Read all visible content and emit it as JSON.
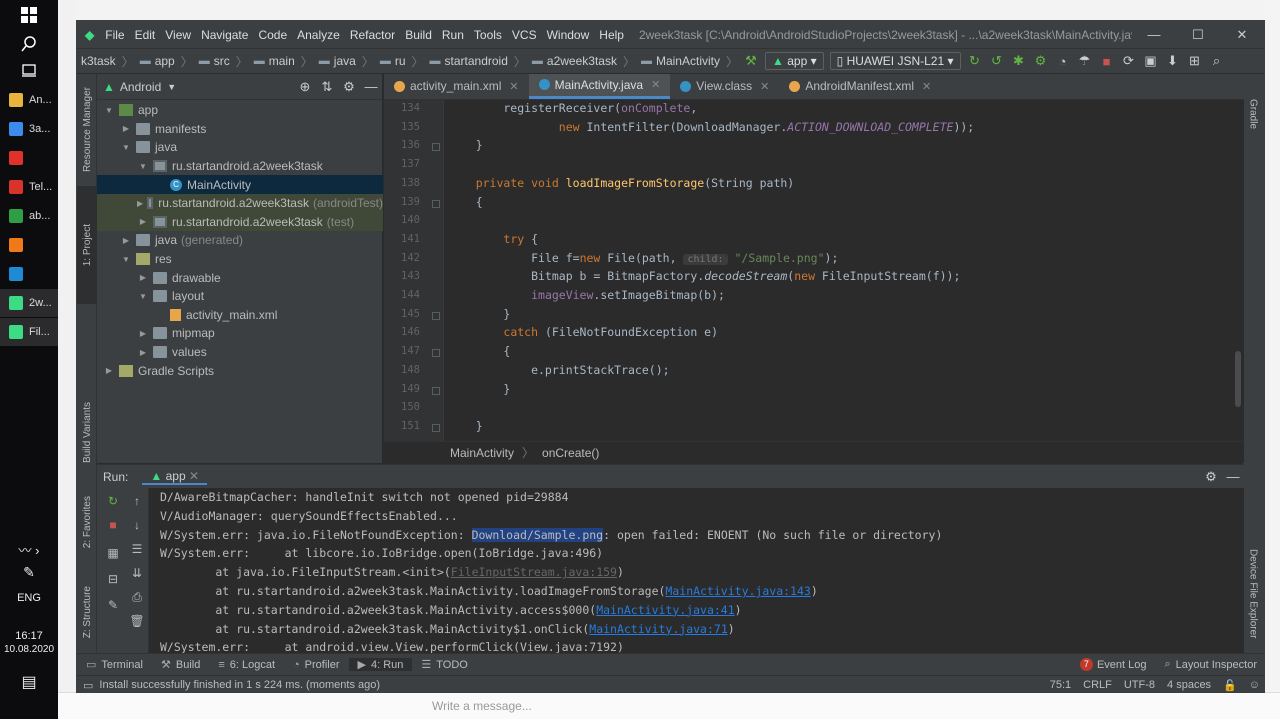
{
  "taskbar": {
    "items": [
      {
        "label": "An...",
        "icon": "folder-icon",
        "color": "#e8b43c"
      },
      {
        "label": "3a...",
        "icon": "download-icon",
        "color": "#3c8cf0"
      },
      {
        "label": "",
        "icon": "yandex-icon",
        "color": "#e0312b"
      },
      {
        "label": "Tel...",
        "icon": "telegram-icon",
        "color": "#d9332a"
      },
      {
        "label": "ab...",
        "icon": "chrome-icon",
        "color": "#2f9e45"
      },
      {
        "label": "",
        "icon": "firefox-icon",
        "color": "#f07a1a"
      },
      {
        "label": "",
        "icon": "edge-icon",
        "color": "#1f8bd6"
      },
      {
        "label": "2w...",
        "icon": "android-studio-icon",
        "color": "#3ddc84"
      },
      {
        "label": "Fil...",
        "icon": "android-studio-icon",
        "color": "#3ddc84"
      }
    ],
    "language": "ENG",
    "time": "16:17",
    "date": "10.08.2020"
  },
  "menu": [
    "File",
    "Edit",
    "View",
    "Navigate",
    "Code",
    "Analyze",
    "Refactor",
    "Build",
    "Run",
    "Tools",
    "VCS",
    "Window",
    "Help"
  ],
  "window_title": "2week3task [C:\\Android\\AndroidStudioProjects\\2week3task] - ...\\a2week3task\\MainActivity.java [app]",
  "breadcrumb": [
    "k3task",
    "app",
    "src",
    "main",
    "java",
    "ru",
    "startandroid",
    "a2week3task",
    "MainActivity"
  ],
  "run_config": "app",
  "device": "HUAWEI JSN-L21",
  "project_panel": {
    "view_mode": "Android",
    "tree": [
      {
        "label": "app",
        "depth": 0,
        "icon": "app",
        "open": true
      },
      {
        "label": "manifests",
        "depth": 1,
        "icon": "folder",
        "open": false
      },
      {
        "label": "java",
        "depth": 1,
        "icon": "folder",
        "open": true
      },
      {
        "label": "ru.startandroid.a2week3task",
        "depth": 2,
        "icon": "pkg",
        "open": true
      },
      {
        "label": "MainActivity",
        "depth": 3,
        "icon": "class",
        "selected": true
      },
      {
        "label": "ru.startandroid.a2week3task",
        "suffix": "(androidTest)",
        "depth": 2,
        "icon": "pkg",
        "open": false,
        "tinted": true
      },
      {
        "label": "ru.startandroid.a2week3task",
        "suffix": "(test)",
        "depth": 2,
        "icon": "pkg",
        "open": false,
        "tinted": true
      },
      {
        "label": "java",
        "suffix": "(generated)",
        "depth": 1,
        "icon": "folder",
        "open": false
      },
      {
        "label": "res",
        "depth": 1,
        "icon": "res",
        "open": true
      },
      {
        "label": "drawable",
        "depth": 2,
        "icon": "folder",
        "open": false
      },
      {
        "label": "layout",
        "depth": 2,
        "icon": "folder",
        "open": true
      },
      {
        "label": "activity_main.xml",
        "depth": 3,
        "icon": "file"
      },
      {
        "label": "mipmap",
        "depth": 2,
        "icon": "folder",
        "open": false
      },
      {
        "label": "values",
        "depth": 2,
        "icon": "folder",
        "open": false
      },
      {
        "label": "Gradle Scripts",
        "depth": 0,
        "icon": "gradle",
        "open": false
      }
    ]
  },
  "left_tool_tabs": [
    "Resource Manager",
    "1: Project",
    "Build Variants",
    "2: Favorites",
    "Z: Structure"
  ],
  "right_tool_tabs": [
    "Gradle",
    "Device File Explorer"
  ],
  "editor_tabs": [
    {
      "label": "activity_main.xml",
      "color": "#e8a64c",
      "active": false
    },
    {
      "label": "MainActivity.java",
      "color": "#3592c4",
      "active": true
    },
    {
      "label": "View.class",
      "color": "#3592c4",
      "active": false
    },
    {
      "label": "AndroidManifest.xml",
      "color": "#e8a64c",
      "active": false
    }
  ],
  "code": {
    "line_numbers": [
      "134",
      "135",
      "136",
      "137",
      "138",
      "139",
      "140",
      "141",
      "142",
      "143",
      "144",
      "145",
      "146",
      "147",
      "148",
      "149",
      "150",
      "151"
    ],
    "lines": [
      [
        {
          "t": "        registerReceiver(",
          "c": ""
        },
        {
          "t": "onComplete",
          "c": "fld"
        },
        {
          "t": ",",
          "c": ""
        }
      ],
      [
        {
          "t": "                ",
          "c": ""
        },
        {
          "t": "new ",
          "c": "kw"
        },
        {
          "t": "IntentFilter(DownloadManager.",
          "c": ""
        },
        {
          "t": "ACTION_DOWNLOAD_COMPLETE",
          "c": "fld itl"
        },
        {
          "t": "));",
          "c": ""
        }
      ],
      [
        {
          "t": "    }",
          "c": ""
        }
      ],
      [
        {
          "t": "",
          "c": ""
        }
      ],
      [
        {
          "t": "    ",
          "c": ""
        },
        {
          "t": "private void ",
          "c": "kw"
        },
        {
          "t": "loadImageFromStorage",
          "c": "fn"
        },
        {
          "t": "(String path)",
          "c": ""
        }
      ],
      [
        {
          "t": "    {",
          "c": ""
        }
      ],
      [
        {
          "t": "",
          "c": ""
        }
      ],
      [
        {
          "t": "        ",
          "c": ""
        },
        {
          "t": "try ",
          "c": "kw"
        },
        {
          "t": "{",
          "c": ""
        }
      ],
      [
        {
          "t": "            File f=",
          "c": ""
        },
        {
          "t": "new ",
          "c": "kw"
        },
        {
          "t": "File(path, ",
          "c": ""
        },
        {
          "t": "child:",
          "c": "hint"
        },
        {
          "t": " ",
          "c": ""
        },
        {
          "t": "\"/Sample.png\"",
          "c": "str"
        },
        {
          "t": ");",
          "c": ""
        }
      ],
      [
        {
          "t": "            Bitmap b = BitmapFactory.",
          "c": ""
        },
        {
          "t": "decodeStream",
          "c": "itl"
        },
        {
          "t": "(",
          "c": ""
        },
        {
          "t": "new ",
          "c": "kw"
        },
        {
          "t": "FileInputStream(f));",
          "c": ""
        }
      ],
      [
        {
          "t": "            ",
          "c": ""
        },
        {
          "t": "imageView",
          "c": "fld"
        },
        {
          "t": ".setImageBitmap(b);",
          "c": ""
        }
      ],
      [
        {
          "t": "        }",
          "c": ""
        }
      ],
      [
        {
          "t": "        ",
          "c": ""
        },
        {
          "t": "catch ",
          "c": "kw"
        },
        {
          "t": "(FileNotFoundException e)",
          "c": ""
        }
      ],
      [
        {
          "t": "        {",
          "c": ""
        }
      ],
      [
        {
          "t": "            e.printStackTrace();",
          "c": ""
        }
      ],
      [
        {
          "t": "        }",
          "c": ""
        }
      ],
      [
        {
          "t": "",
          "c": ""
        }
      ],
      [
        {
          "t": "    }",
          "c": ""
        }
      ]
    ]
  },
  "editor_breadcrumb": [
    "MainActivity",
    "onCreate()"
  ],
  "run_panel": {
    "title": "Run:",
    "tab": "app",
    "lines": [
      [
        {
          "t": "D/AwareBitmapCacher: handleInit switch not opened pid=29884",
          "c": ""
        }
      ],
      [
        {
          "t": "V/AudioManager: querySoundEffectsEnabled...",
          "c": ""
        }
      ],
      [
        {
          "t": "W/System.err: java.io.FileNotFoundException: ",
          "c": ""
        },
        {
          "t": "Download/Sample.png",
          "c": "sel"
        },
        {
          "t": ": open failed: ENOENT (No such file or directory)",
          "c": ""
        }
      ],
      [
        {
          "t": "W/System.err:     at libcore.io.IoBridge.open(IoBridge.java:496)",
          "c": ""
        }
      ],
      [
        {
          "t": "        at java.io.FileInputStream.<init>(",
          "c": ""
        },
        {
          "t": "FileInputStream.java:159",
          "c": "lnk-dim"
        },
        {
          "t": ")",
          "c": ""
        }
      ],
      [
        {
          "t": "        at ru.startandroid.a2week3task.MainActivity.loadImageFromStorage(",
          "c": ""
        },
        {
          "t": "MainActivity.java:143",
          "c": "lnk"
        },
        {
          "t": ")",
          "c": ""
        }
      ],
      [
        {
          "t": "        at ru.startandroid.a2week3task.MainActivity.access$000(",
          "c": ""
        },
        {
          "t": "MainActivity.java:41",
          "c": "lnk"
        },
        {
          "t": ")",
          "c": ""
        }
      ],
      [
        {
          "t": "        at ru.startandroid.a2week3task.MainActivity$1.onClick(",
          "c": ""
        },
        {
          "t": "MainActivity.java:71",
          "c": "lnk"
        },
        {
          "t": ")",
          "c": ""
        }
      ],
      [
        {
          "t": "W/System.err:     at android.view.View.performClick(View.java:7192)",
          "c": ""
        }
      ]
    ]
  },
  "bottom_tabs": [
    {
      "label": "Terminal",
      "glyph": "▭",
      "active": false
    },
    {
      "label": "Build",
      "glyph": "⚒",
      "active": false
    },
    {
      "label": "6: Logcat",
      "glyph": "≡",
      "active": false
    },
    {
      "label": "Profiler",
      "glyph": "◔",
      "active": false
    },
    {
      "label": "4: Run",
      "glyph": "▶",
      "active": true
    },
    {
      "label": "TODO",
      "glyph": "☰",
      "active": false
    }
  ],
  "event_log": {
    "label": "Event Log",
    "count": "7"
  },
  "layout_inspector": "Layout Inspector",
  "status": {
    "message": "Install successfully finished in 1 s 224 ms. (moments ago)",
    "position": "75:1",
    "line_sep": "CRLF",
    "encoding": "UTF-8",
    "indent": "4 spaces"
  },
  "background": {
    "message_placeholder": "Write a message..."
  }
}
